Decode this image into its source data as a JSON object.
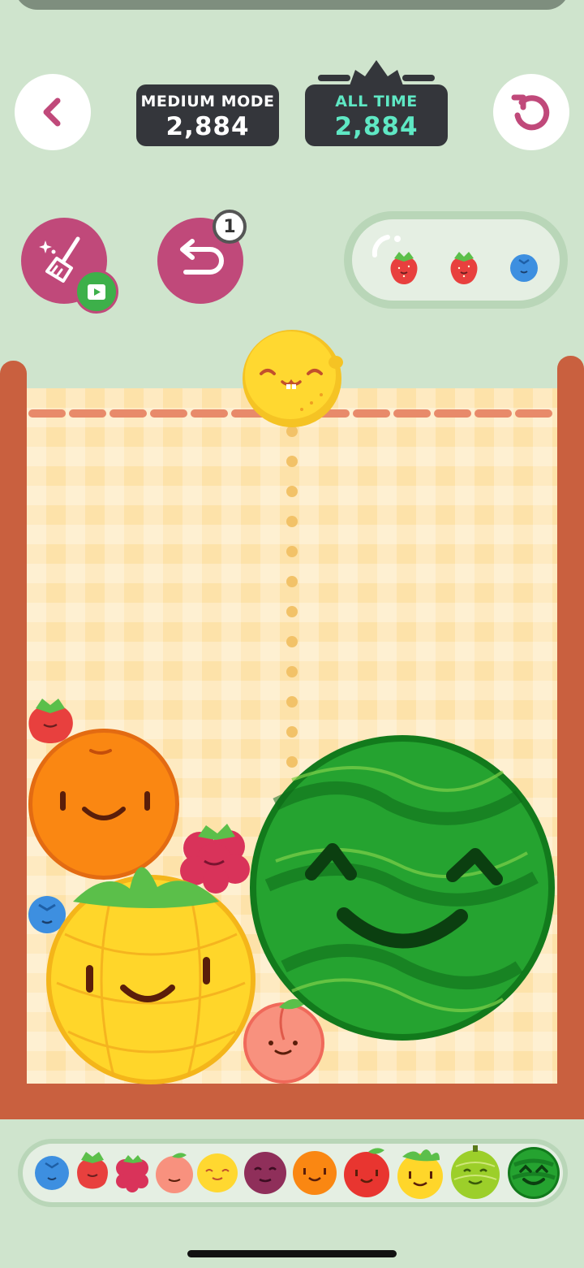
{
  "scores": {
    "mode_label": "MEDIUM MODE",
    "mode_score": "2,884",
    "alltime_label": "ALL TIME",
    "alltime_score": "2,884"
  },
  "powerups": {
    "undo_count": "1"
  },
  "queue": {
    "next_fruits": [
      "strawberry-icon",
      "strawberry-icon",
      "blueberry-icon"
    ]
  },
  "current_drop": "lemon-icon",
  "board_fruits": [
    "strawberry",
    "orange",
    "raspberry",
    "blueberry",
    "pineapple",
    "peach",
    "watermelon"
  ],
  "evolution_chain": [
    "blueberry",
    "strawberry",
    "raspberry",
    "peach",
    "lemon",
    "plum",
    "orange",
    "apple",
    "pineapple",
    "melon",
    "watermelon"
  ],
  "colors": {
    "background": "#cfe4cd",
    "score_box": "#34363b",
    "alltime_accent": "#5fe8c4",
    "powerup": "#c0497a",
    "box_wall": "#c9603f",
    "box_inside": "#fde2a9"
  }
}
